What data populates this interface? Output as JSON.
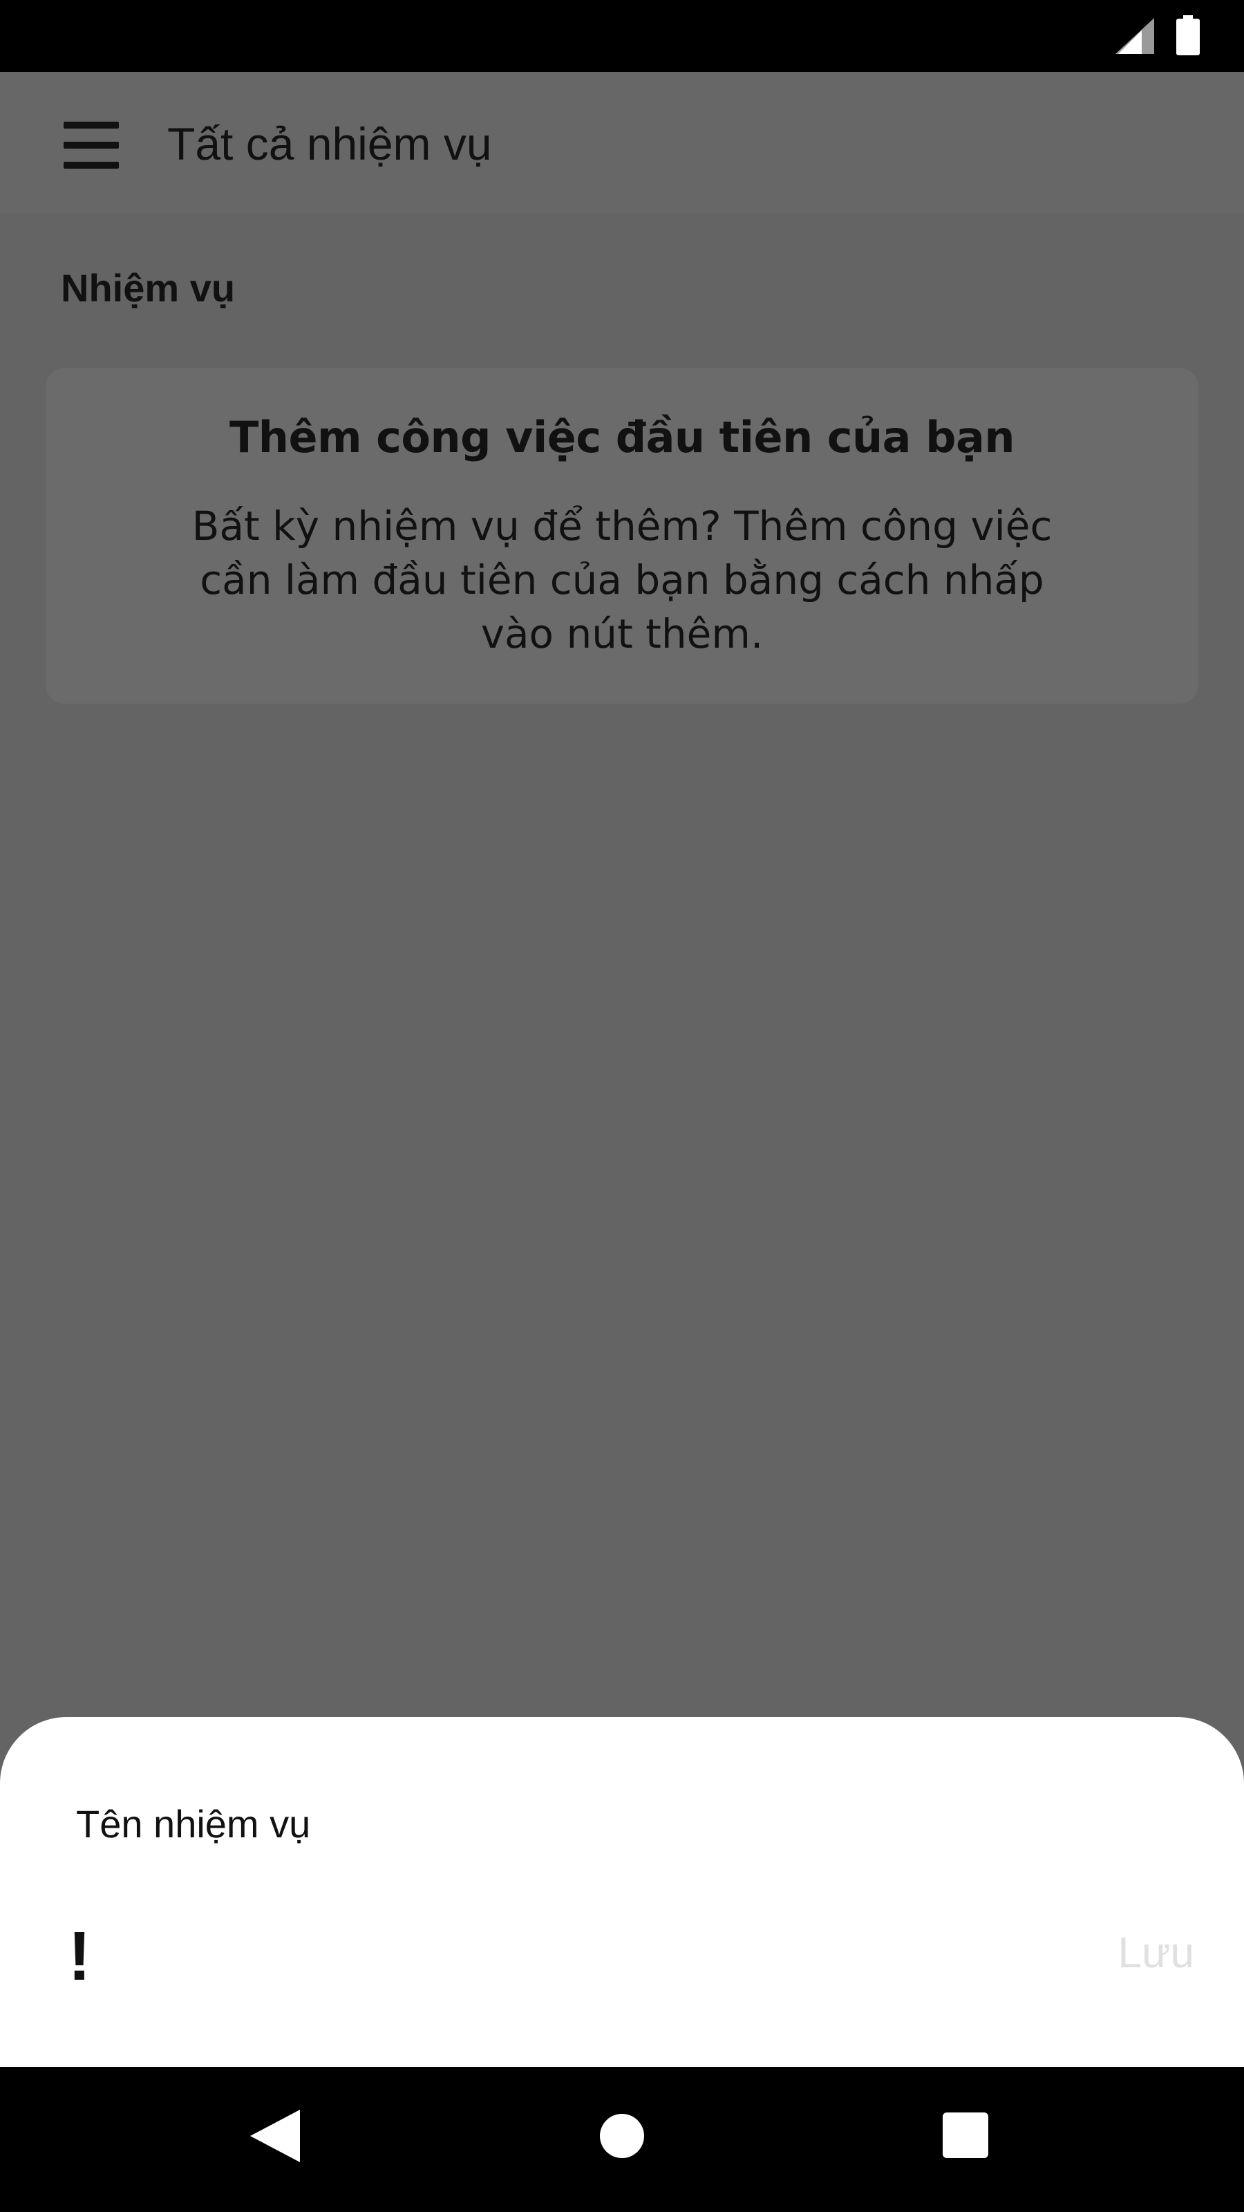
{
  "status_bar": {
    "signal_icon": "cell-signal-icon",
    "battery_icon": "battery-icon"
  },
  "app_bar": {
    "menu_icon": "hamburger-menu-icon",
    "title": "Tất cả nhiệm vụ"
  },
  "tasks_section": {
    "label": "Nhiệm vụ"
  },
  "empty_state": {
    "title": "Thêm công việc đầu tiên của bạn",
    "body": "Bất kỳ nhiệm vụ để thêm? Thêm công việc cần làm đầu tiên của bạn bằng cách nhấp vào nút thêm."
  },
  "bottom_sheet": {
    "task_name_placeholder": "Tên nhiệm vụ",
    "task_name_value": "",
    "priority_icon_glyph": "!",
    "priority_icon": "priority-exclamation-icon",
    "save_label": "Lưu"
  },
  "nav_bar": {
    "back_icon": "back-triangle-icon",
    "home_icon": "home-circle-icon",
    "recents_icon": "recents-square-icon"
  },
  "colors": {
    "scrim": "#646464",
    "sheet": "#ffffff",
    "save_disabled": "#e0e0e0",
    "bar": "#000000"
  }
}
